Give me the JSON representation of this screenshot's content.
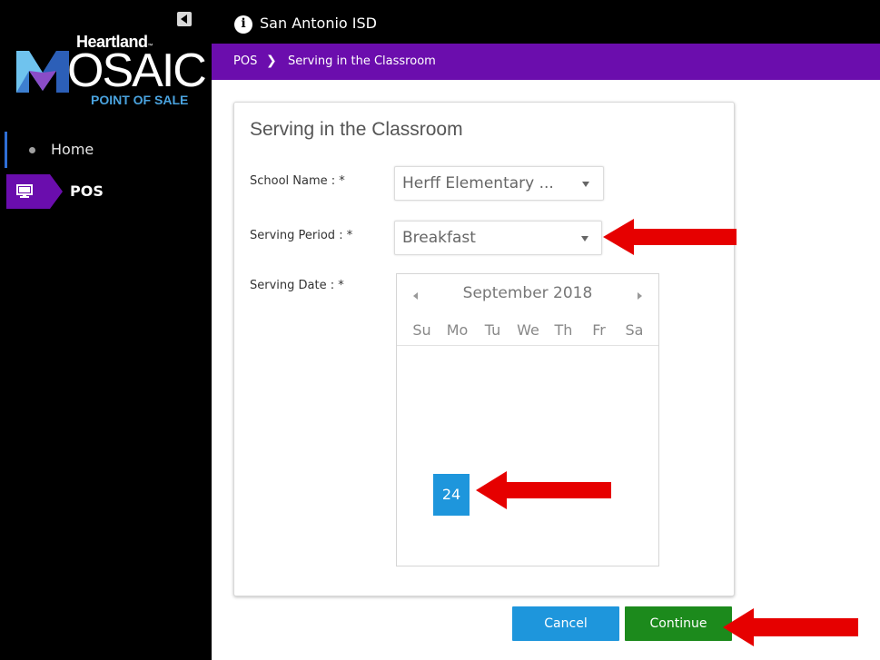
{
  "sidebar": {
    "logo": {
      "brand": "Heartland",
      "trademark": "™",
      "product_rest": "OSAIC",
      "subtitle": "POINT OF SALE"
    },
    "items": [
      {
        "label": "Home",
        "icon": "bullet-icon"
      },
      {
        "label": "POS",
        "icon": "monitor-icon"
      }
    ],
    "colors": {
      "active_tab": "#6a0dad",
      "active_indicator": "#2f6fd6"
    }
  },
  "header": {
    "district": "San Antonio ISD",
    "icon": "info-icon"
  },
  "breadcrumb": {
    "root": "POS",
    "separator": "❯",
    "current": "Serving in the Classroom",
    "color": "#6b0dad"
  },
  "form": {
    "title": "Serving in the Classroom",
    "school_name_label": "School Name : *",
    "school_name_value": "Herff Elementary ...",
    "serving_period_label": "Serving Period : *",
    "serving_period_value": "Breakfast",
    "serving_date_label": "Serving Date : *"
  },
  "calendar": {
    "month": "September 2018",
    "weekdays": [
      "Su",
      "Mo",
      "Tu",
      "We",
      "Th",
      "Fr",
      "Sa"
    ],
    "selected_day": "24",
    "selected_color": "#1e96dc"
  },
  "buttons": {
    "cancel": "Cancel",
    "continue": "Continue",
    "cancel_color": "#1e96dc",
    "continue_color": "#1c8a1c"
  },
  "annotations": {
    "arrow_color": "#e60000"
  }
}
